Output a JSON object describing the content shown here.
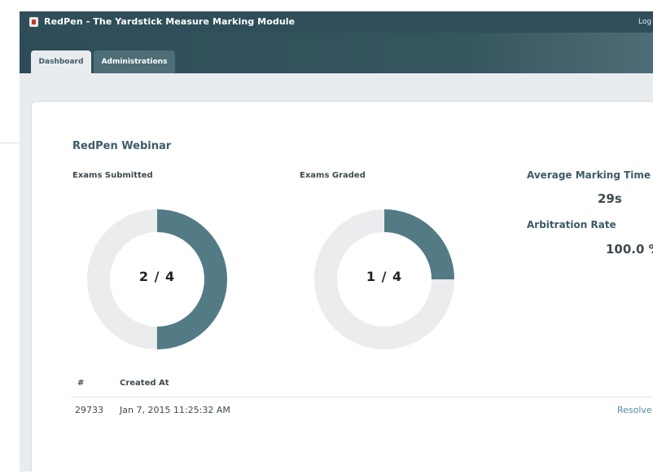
{
  "app": {
    "title": "RedPen - The Yardstick Measure Marking Module",
    "logout_label": "Log"
  },
  "tabs": [
    {
      "label": "Dashboard",
      "active": true
    },
    {
      "label": "Administrations",
      "active": false
    }
  ],
  "dashboard": {
    "title": "RedPen Webinar",
    "exams_submitted": {
      "label": "Exams Submitted",
      "value": "2 / 4",
      "fraction": 0.5
    },
    "exams_graded": {
      "label": "Exams Graded",
      "value": "1 / 4",
      "fraction": 0.25
    },
    "average_marking_time": {
      "label": "Average Marking Time",
      "value": "29s"
    },
    "arbitration_rate": {
      "label": "Arbitration Rate",
      "value": "100.0 %"
    }
  },
  "table": {
    "headers": [
      "#",
      "Created At"
    ],
    "rows": [
      {
        "id": "29733",
        "created_at": "Jan 7, 2015 11:25:32 AM",
        "action": "Resolve"
      }
    ]
  },
  "colors": {
    "donut_fill": "#537b86",
    "donut_track": "#eaeced",
    "accent": "#3c5b66",
    "link": "#4b8fa8"
  }
}
